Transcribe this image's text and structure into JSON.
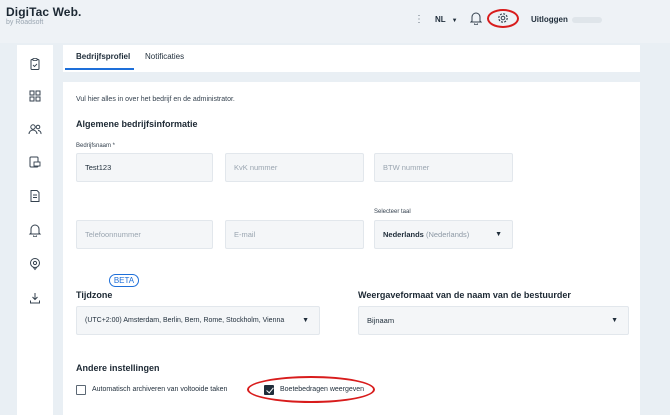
{
  "app": {
    "title": "DigiTac Web.",
    "subtitle": "by Roadsoft"
  },
  "topbar": {
    "menu_dots": "⋮",
    "language": "NL",
    "logout_label": "Uitloggen"
  },
  "tabs": [
    {
      "label": "Bedrijfsprofiel",
      "active": true
    },
    {
      "label": "Notificaties",
      "active": false
    }
  ],
  "intro_text": "Vul hier alles in over het bedrijf en de administrator.",
  "company_info": {
    "section_title": "Algemene bedrijfsinformatie",
    "company_name_label": "Bedrijfsnaam *",
    "company_name_value": "Test123",
    "kvk_placeholder": "KvK nummer",
    "btw_placeholder": "BTW nummer",
    "phone_placeholder": "Telefoonnummer",
    "email_placeholder": "E-mail",
    "language_label": "Selecteer taal",
    "language_value": "Nederlands",
    "language_native": "(Nederlands)"
  },
  "timezone": {
    "badge": "BETA",
    "title": "Tijdzone",
    "value": "(UTC+2:00) Amsterdam, Berlin, Bern, Rome, Stockholm, Vienna"
  },
  "driver_name_format": {
    "title": "Weergaveformaat van de naam van de bestuurder",
    "value": "Bijnaam"
  },
  "other_settings": {
    "title": "Andere instellingen",
    "auto_archive_label": "Automatisch archiveren van voltooide taken",
    "auto_archive_checked": false,
    "show_fines_label": "Boetebedragen weergeven",
    "show_fines_checked": true
  },
  "colors": {
    "accent": "#1e6fd9",
    "annotation": "#d81c1c",
    "background": "#e9eff4"
  }
}
